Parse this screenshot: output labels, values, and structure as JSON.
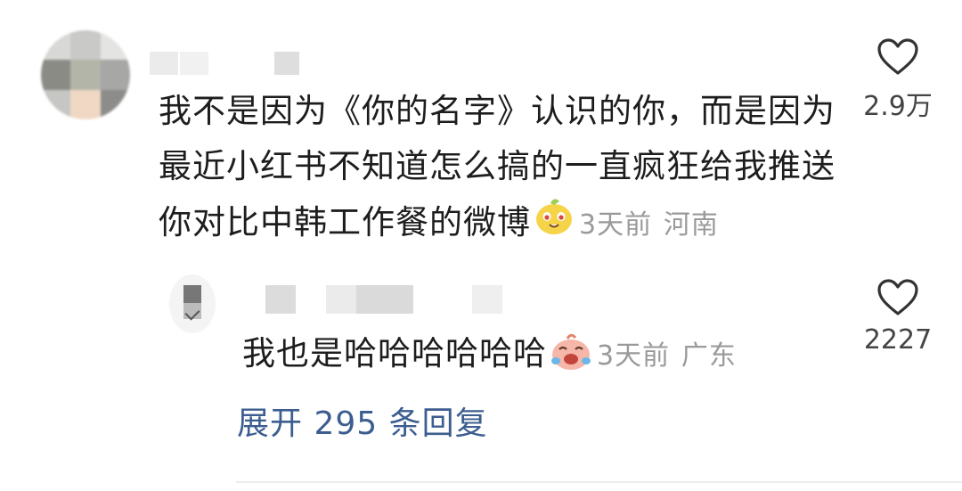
{
  "comment": {
    "text": "我不是因为《你的名字》认识的你，而是因为最近小红书不知道怎么搞的一直疯狂给我推送你对比中韩工作餐的微博",
    "time": "3天前",
    "location": "河南",
    "likes": "2.9万",
    "emoji": "smiling-yellow-face-emoji"
  },
  "reply": {
    "text": "我也是哈哈哈哈哈哈",
    "time": "3天前",
    "location": "广东",
    "likes": "2227",
    "emoji": "crying-laughing-pink-face-emoji"
  },
  "expand_replies_label": "展开 295 条回复",
  "colors": {
    "link": "#3c5d8f",
    "meta": "#9a9a9a",
    "text": "#1d1d1d"
  }
}
